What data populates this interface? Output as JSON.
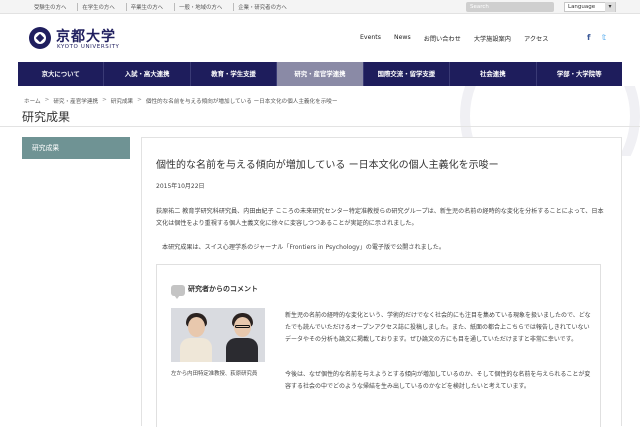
{
  "topbar": {
    "links": [
      "受験生の方へ",
      "在学生の方へ",
      "卒業生の方へ",
      "一般・地域の方へ",
      "企業・研究者の方へ"
    ],
    "search_placeholder": "Search",
    "language_label": "Language",
    "language_caret": "▾"
  },
  "header": {
    "logo_jp": "京都大学",
    "logo_en": "KYOTO UNIVERSITY",
    "nav": [
      "Events",
      "News",
      "お問い合わせ",
      "大学施設案内",
      "アクセス"
    ],
    "facebook": "f",
    "twitter": "𝕥"
  },
  "mainnav": {
    "items": [
      "京大について",
      "入試・高大連携",
      "教育・学生支援",
      "研究・産官学連携",
      "国際交流・留学支援",
      "社会連携",
      "学部・大学院等"
    ],
    "active_index": 3
  },
  "breadcrumb": {
    "items": [
      "ホーム",
      "研究・産官学連携",
      "研究成果",
      "個性的な名前を与える傾向が増加している ー日本文化の個人主義化を示唆ー"
    ],
    "separator": ">"
  },
  "page_title": "研究成果",
  "sidebar": {
    "active_label": "研究成果"
  },
  "article": {
    "title": "個性的な名前を与える傾向が増加している ー日本文化の個人主義化を示唆ー",
    "date": "2015年10月22日",
    "para1": "荻原祐二 教育学研究科研究員、内田由紀子 こころの未来研究センター特定准教授らの研究グループは、新生児の名前の経時的な変化を分析することによって、日本文化は個性をより重視する個人主義文化に徐々に変容しつつあることが実証的に示されました。",
    "para2": "本研究成果は、スイス心理学系のジャーナル「Frontiers in Psychology」の電子版で公開されました。"
  },
  "comment": {
    "heading": "研究者からのコメント",
    "caption": "左から内田特定准教授、荻原研究員",
    "p1": "新生児の名前の経時的な変化という、学術的だけでなく社会的にも注目を集めている現象を扱いましたので、どなたでも読んでいただけるオープンアクセス誌に投稿しました。また、紙面の都合上こちらでは報告しきれていないデータやその分析も論文に掲載しております。ぜひ論文の方にも目を通していただけますと非常に幸いです。",
    "p2": "今後は、なぜ個性的な名前を与えようとする傾向が増加しているのか、そして個性的な名前を与えられることが変容する社会の中でどのような帰結を生み出しているのかなどを検討したいと考えています。"
  },
  "colors": {
    "navy": "#1e1d5c",
    "nav_active": "#8a8aa6",
    "sidebar_teal": "#6f9394"
  }
}
